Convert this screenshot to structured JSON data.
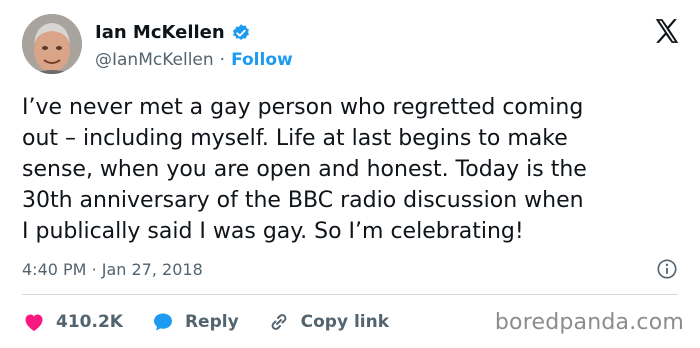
{
  "author": {
    "name": "Ian McKellen",
    "handle": "@IanMcKellen",
    "separator": "·",
    "follow_label": "Follow"
  },
  "tweet": {
    "text": "I’ve never met a gay person who regretted coming\nout – including myself. Life at last begins to make\nsense, when you are open and honest. Today is the\n30th anniversary of the BBC radio discussion when\nI publically said I was gay. So I’m celebrating!",
    "time": "4:40 PM",
    "date_separator": "·",
    "date": "Jan 27, 2018"
  },
  "actions": {
    "likes": "410.2K",
    "reply_label": "Reply",
    "copy_link_label": "Copy link"
  },
  "watermark": "boredpanda.com",
  "colors": {
    "verified": "#1d9bf0",
    "follow": "#1d9bf0",
    "like": "#f91880",
    "reply_icon": "#1d9bf0",
    "text": "#0f1419",
    "secondary": "#536471"
  },
  "icons": {
    "verified": "verified-badge-icon",
    "platform": "x-logo-icon",
    "info": "info-icon",
    "like": "heart-icon",
    "reply": "reply-bubble-icon",
    "copy_link": "link-icon"
  }
}
